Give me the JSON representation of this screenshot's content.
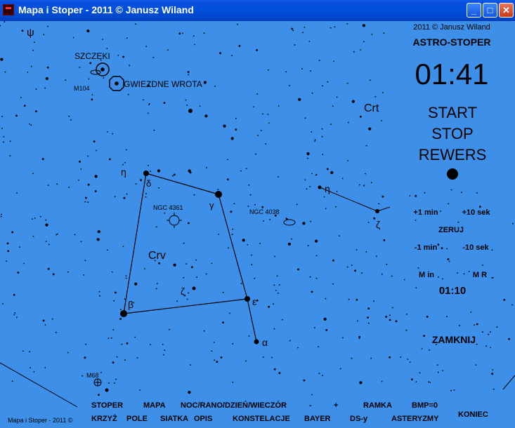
{
  "window": {
    "title": "Mapa i Stoper - 2011 © Janusz Wiland",
    "minimize": "_",
    "maximize": "□",
    "close": "✕"
  },
  "map_labels": {
    "psi": "ψ",
    "szczeki": "SZCZĘKI",
    "m104": "M104",
    "gwiezdne_wrota": "GWIEZDNE WROTA",
    "crt": "Crt",
    "eta_crv": "η",
    "delta": "δ",
    "gamma": "γ",
    "ngc4361": "NGC 4361",
    "ngc4038": "NGC 4038",
    "eta_crt": "η",
    "zeta_crt": "ζ",
    "crv": "Crv",
    "zeta_crv": "ζ",
    "beta": "β",
    "epsilon": "ε",
    "alpha": "α",
    "m68": "M68",
    "footer_credit": "Mapa i Stoper - 2011 ©"
  },
  "panel": {
    "copyright": "2011 © Janusz Wiland",
    "app_name": "ASTRO-STOPER",
    "timer": "01:41",
    "start": "START",
    "stop": "STOP",
    "rewers": "REWERS",
    "plus_1_min": "+1 min",
    "plus_10_sek": "+10 sek",
    "zeruj": "ZERUJ",
    "minus_1_min": "-1 min",
    "minus_10_sek": "-10 sek",
    "m_in": "M in",
    "m_r": "M R",
    "small_timer": "01:10",
    "zamknij": "ZAMKNIJ"
  },
  "bottom_bar": {
    "row1": [
      "STOPER",
      "MAPA",
      "NOC/RANO/DZIEŃ/WIECZÓR",
      "-",
      "+",
      "RAMKA",
      "BMP=0"
    ],
    "koniec": "KONIEC",
    "row2": [
      "KRZYŻ",
      "POLE",
      "SIATKA",
      "OPIS",
      "KONSTELACJE",
      "BAYER",
      "DS-y",
      "ASTERYZMY"
    ]
  },
  "colors": {
    "sky": "#3d8fe8",
    "titlebar": "#0051d8",
    "ink": "#000000",
    "indicator": "#000000"
  }
}
